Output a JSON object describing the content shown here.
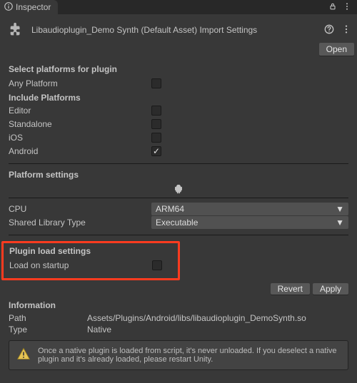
{
  "tab": {
    "title": "Inspector"
  },
  "header": {
    "title": "Libaudioplugin_Demo Synth (Default Asset) Import Settings",
    "open": "Open"
  },
  "sections": {
    "select_platforms": "Select platforms for plugin",
    "include_platforms": "Include Platforms",
    "platform_settings": "Platform settings",
    "plugin_load_settings": "Plugin load settings",
    "information": "Information"
  },
  "platforms": {
    "any": {
      "label": "Any Platform",
      "checked": false
    },
    "list": [
      {
        "label": "Editor",
        "checked": false
      },
      {
        "label": "Standalone",
        "checked": false
      },
      {
        "label": "iOS",
        "checked": false
      },
      {
        "label": "Android",
        "checked": true
      }
    ]
  },
  "platform_settings": {
    "active_icon": "android-icon",
    "cpu": {
      "label": "CPU",
      "value": "ARM64"
    },
    "shared_lib": {
      "label": "Shared Library Type",
      "value": "Executable"
    }
  },
  "load": {
    "label": "Load on startup",
    "checked": false
  },
  "buttons": {
    "revert": "Revert",
    "apply": "Apply"
  },
  "info": {
    "path_label": "Path",
    "path_value": "Assets/Plugins/Android/libs/libaudioplugin_DemoSynth.so",
    "type_label": "Type",
    "type_value": "Native"
  },
  "warning": "Once a native plugin is loaded from script, it's never unloaded. If you deselect a native plugin and it's already loaded, please restart Unity."
}
